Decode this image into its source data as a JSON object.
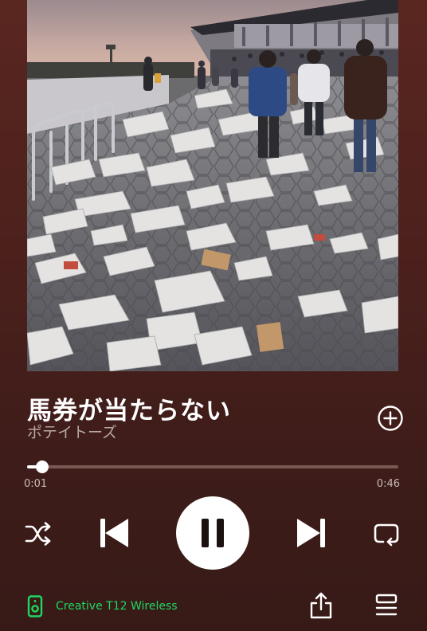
{
  "track": {
    "title": "馬券が当たらない",
    "artist": "ポテイトーズ"
  },
  "playback": {
    "elapsed": "0:01",
    "total": "0:46",
    "progress_fraction": 0.04,
    "state": "playing"
  },
  "device": {
    "name": "Creative T12 Wireless"
  },
  "colors": {
    "background": "#4a201c",
    "accent_green": "#1ed760",
    "progress_track": "#7a5753"
  },
  "icons": {
    "add": "add-circle-icon",
    "shuffle": "shuffle-icon",
    "previous": "skip-back-icon",
    "pause": "pause-icon",
    "next": "skip-forward-icon",
    "repeat": "repeat-icon",
    "device": "speaker-icon",
    "share": "share-icon",
    "queue": "queue-icon"
  }
}
